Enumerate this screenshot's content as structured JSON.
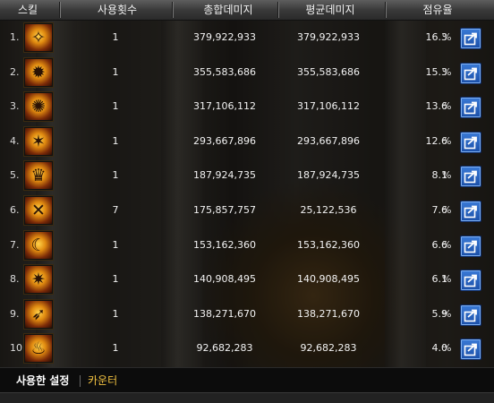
{
  "header": {
    "skill": "스킬",
    "uses": "사용횟수",
    "total": "총합데미지",
    "avg": "평균데미지",
    "share": "점유율"
  },
  "rows": [
    {
      "rank": "1.",
      "uses": "1",
      "total": "379,922,933",
      "avg": "379,922,933",
      "share": "16.3",
      "pct": "%",
      "icon": "skill-icon-1"
    },
    {
      "rank": "2.",
      "uses": "1",
      "total": "355,583,686",
      "avg": "355,583,686",
      "share": "15.3",
      "pct": "%",
      "icon": "skill-icon-2"
    },
    {
      "rank": "3.",
      "uses": "1",
      "total": "317,106,112",
      "avg": "317,106,112",
      "share": "13.6",
      "pct": "%",
      "icon": "skill-icon-3"
    },
    {
      "rank": "4.",
      "uses": "1",
      "total": "293,667,896",
      "avg": "293,667,896",
      "share": "12.6",
      "pct": "%",
      "icon": "skill-icon-4"
    },
    {
      "rank": "5.",
      "uses": "1",
      "total": "187,924,735",
      "avg": "187,924,735",
      "share": "8.1",
      "pct": "%",
      "icon": "skill-icon-5"
    },
    {
      "rank": "6.",
      "uses": "7",
      "total": "175,857,757",
      "avg": "25,122,536",
      "share": "7.6",
      "pct": "%",
      "icon": "skill-icon-6"
    },
    {
      "rank": "7.",
      "uses": "1",
      "total": "153,162,360",
      "avg": "153,162,360",
      "share": "6.6",
      "pct": "%",
      "icon": "skill-icon-7"
    },
    {
      "rank": "8.",
      "uses": "1",
      "total": "140,908,495",
      "avg": "140,908,495",
      "share": "6.1",
      "pct": "%",
      "icon": "skill-icon-8"
    },
    {
      "rank": "9.",
      "uses": "1",
      "total": "138,271,670",
      "avg": "138,271,670",
      "share": "5.9",
      "pct": "%",
      "icon": "skill-icon-9"
    },
    {
      "rank": "10.",
      "uses": "1",
      "total": "92,682,283",
      "avg": "92,682,283",
      "share": "4.0",
      "pct": "%",
      "icon": "skill-icon-10"
    }
  ],
  "footer": {
    "tab_settings": "사용한 설정",
    "tab_counter": "카운터"
  },
  "colors": {
    "share_button": "#2a62c0",
    "counter_tab": "#f0c040"
  }
}
